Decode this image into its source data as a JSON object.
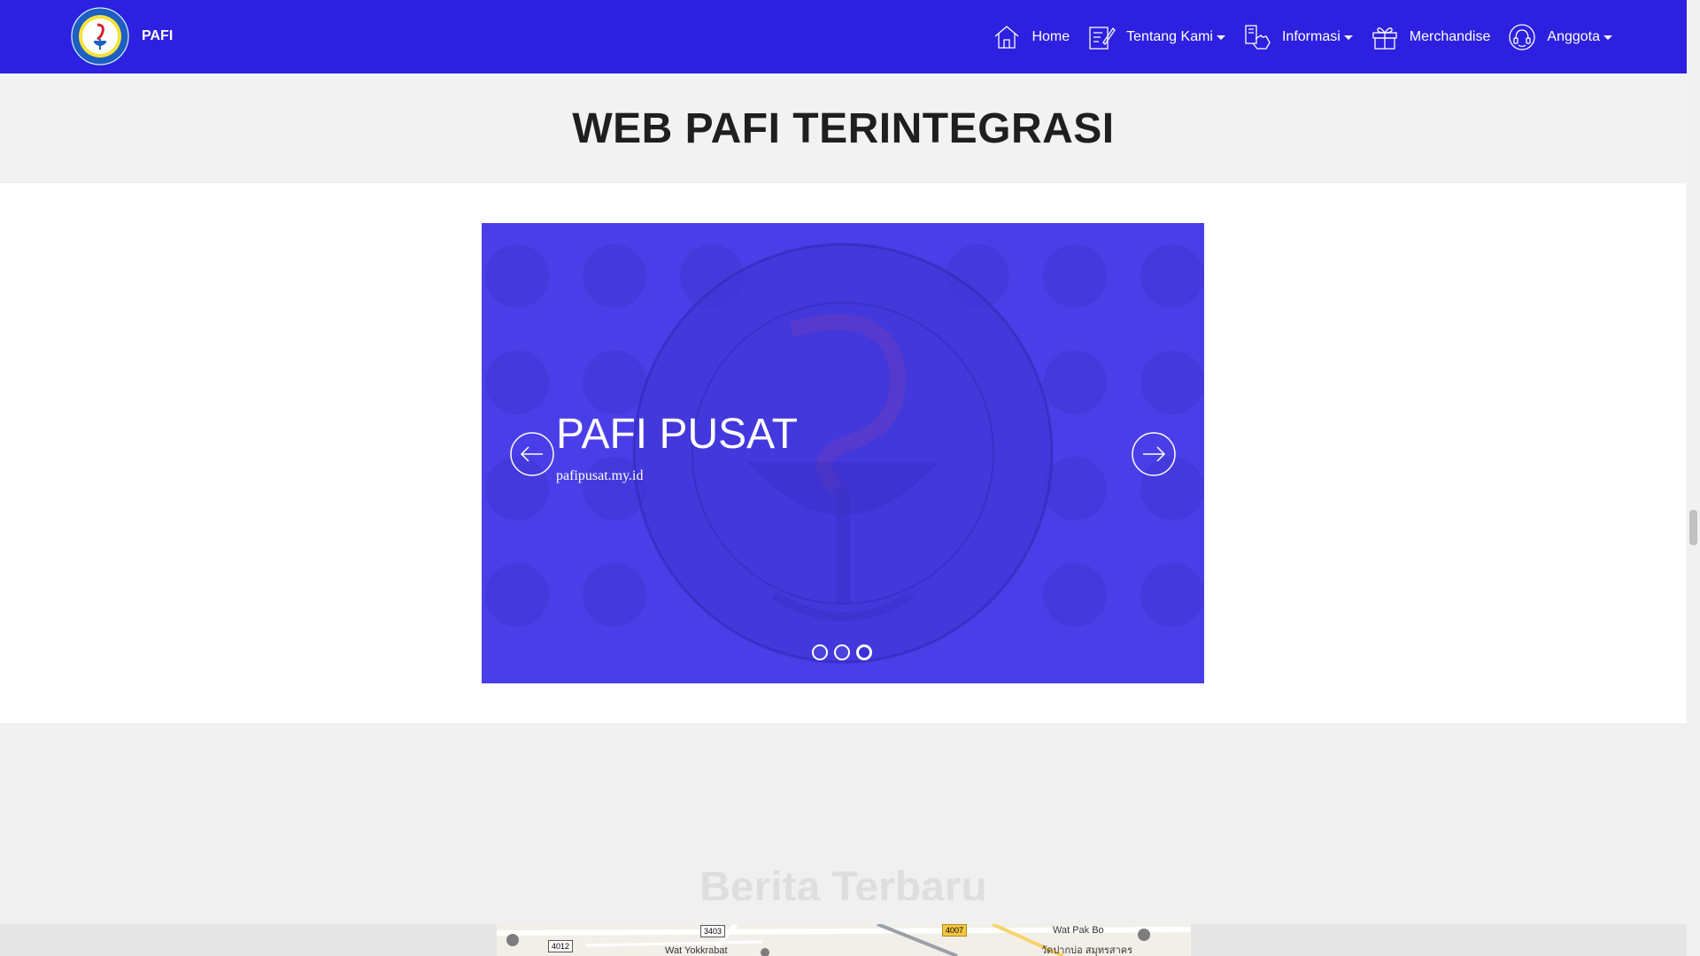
{
  "header": {
    "brand_text": "PAFI",
    "logo_icon": "pafi-logo-icon",
    "nav": [
      {
        "label": "Home",
        "icon": "home-icon",
        "dropdown": false
      },
      {
        "label": "Tentang Kami",
        "icon": "edit-note-icon",
        "dropdown": true
      },
      {
        "label": "Informasi",
        "icon": "info-touch-icon",
        "dropdown": true
      },
      {
        "label": "Merchandise",
        "icon": "gift-icon",
        "dropdown": false
      },
      {
        "label": "Anggota",
        "icon": "headset-user-icon",
        "dropdown": true
      }
    ]
  },
  "page_title": "WEB PAFI TERINTEGRASI",
  "carousel": {
    "slide_title": "PAFI PUSAT",
    "slide_subtitle": "pafipusat.my.id",
    "slide_count": 3,
    "active_slide": 3,
    "prev_icon": "arrow-left-circle-icon",
    "next_icon": "arrow-right-circle-icon"
  },
  "lower": {
    "section_heading": "Berita Terbaru"
  },
  "map": {
    "labels": [
      "Wat Pak Bo",
      "Wat Yokkrabat",
      "วัดปากบ่อ สมุทรสาคร"
    ],
    "route_shields": [
      "4012",
      "3403",
      "4007"
    ]
  },
  "colors": {
    "navbar": "#2d20e0",
    "carousel": "#4a3ee8",
    "title_band": "#f2f2f2"
  }
}
